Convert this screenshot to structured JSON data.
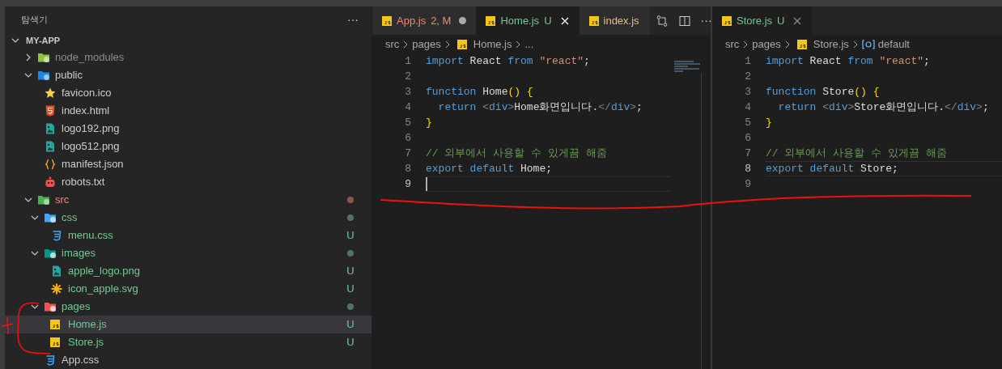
{
  "sidebar": {
    "title": "탐색기",
    "more": "···",
    "root": {
      "label": "MY-APP",
      "expanded": true
    },
    "tree": [
      {
        "label": "node_modules",
        "kind": "nodefolder",
        "color": "#8c8c8c",
        "expanded": false
      },
      {
        "label": "public",
        "kind": "publicfolder",
        "color": "#cccccc",
        "expanded": true,
        "children": [
          {
            "label": "favicon.ico",
            "kind": "star",
            "color": "#cccccc"
          },
          {
            "label": "index.html",
            "kind": "html",
            "color": "#cccccc"
          },
          {
            "label": "logo192.png",
            "kind": "image",
            "color": "#cccccc"
          },
          {
            "label": "logo512.png",
            "kind": "image",
            "color": "#cccccc"
          },
          {
            "label": "manifest.json",
            "kind": "json",
            "color": "#cccccc"
          },
          {
            "label": "robots.txt",
            "kind": "robot",
            "color": "#cccccc"
          }
        ]
      },
      {
        "label": "src",
        "kind": "srcfolder",
        "color": "#f48771",
        "expanded": true,
        "dot": true,
        "children": [
          {
            "label": "css",
            "kind": "cssfolder",
            "color": "#73c991",
            "expanded": true,
            "dot": true,
            "children": [
              {
                "label": "menu.css",
                "kind": "css",
                "color": "#73c991",
                "badge": "U"
              }
            ]
          },
          {
            "label": "images",
            "kind": "imagesfolder",
            "color": "#73c991",
            "expanded": true,
            "dot": true,
            "children": [
              {
                "label": "apple_logo.png",
                "kind": "image",
                "color": "#73c991",
                "badge": "U"
              },
              {
                "label": "icon_apple.svg",
                "kind": "svg",
                "color": "#73c991",
                "badge": "U"
              }
            ]
          },
          {
            "label": "pages",
            "kind": "pagesfolder",
            "color": "#73c991",
            "expanded": true,
            "dot": true,
            "children": [
              {
                "label": "Home.js",
                "kind": "js",
                "color": "#73c991",
                "badge": "U",
                "selected": true
              },
              {
                "label": "Store.js",
                "kind": "js",
                "color": "#73c991",
                "badge": "U",
                "selected": false
              }
            ]
          },
          {
            "label": "App.css",
            "kind": "css",
            "color": "#cccccc"
          }
        ]
      }
    ]
  },
  "editors": [
    {
      "tabs": [
        {
          "label": "App.js",
          "badge": "2, M",
          "color": "#f48771",
          "selected": false,
          "modified": true
        },
        {
          "label": "Home.js",
          "badge": "U",
          "color": "#73c991",
          "selected": true,
          "modified": false
        },
        {
          "label": "index.js",
          "color": "#e2c08d",
          "selected": false,
          "modified": false
        }
      ],
      "breadcrumb": [
        {
          "text": "src",
          "kind": "folder"
        },
        {
          "text": "pages",
          "kind": "folder"
        },
        {
          "text": "Home.js",
          "kind": "js"
        },
        {
          "text": "...",
          "kind": "folder"
        }
      ],
      "lines": [
        {
          "number": "1",
          "current": false,
          "tokens": [
            {
              "text": "import",
              "kind": "kw"
            },
            {
              "text": " React ",
              "kind": "var"
            },
            {
              "text": "from",
              "kind": "kw"
            },
            {
              "text": " \"react\"",
              "kind": "str"
            },
            {
              "text": ";",
              "kind": "plain"
            }
          ]
        },
        {
          "number": "2",
          "current": false
        },
        {
          "number": "3",
          "current": false,
          "tokens": [
            {
              "text": "function",
              "kind": "kw"
            },
            {
              "text": " Home",
              "kind": "fn"
            },
            {
              "text": "()",
              "kind": "br"
            },
            {
              "text": " {",
              "kind": "br"
            }
          ]
        },
        {
          "number": "4",
          "current": false,
          "tokens": [
            {
              "text": "  return",
              "kind": "kw"
            },
            {
              "text": " <",
              "kind": "tag"
            },
            {
              "text": "div",
              "kind": "kw"
            },
            {
              "text": ">",
              "kind": "tag"
            },
            {
              "text": "Home화면입니다.",
              "kind": "plain"
            },
            {
              "text": "</",
              "kind": "tag"
            },
            {
              "text": "div",
              "kind": "kw"
            },
            {
              "text": ">",
              "kind": "tag"
            },
            {
              "text": ";",
              "kind": "plain"
            }
          ]
        },
        {
          "number": "5",
          "current": false,
          "tokens": [
            {
              "text": "}",
              "kind": "br"
            }
          ]
        },
        {
          "number": "6",
          "current": false
        },
        {
          "number": "7",
          "current": false,
          "tokens": [
            {
              "text": "// 외부에서 사용할 수 있게끔 해줌",
              "kind": "cm"
            }
          ]
        },
        {
          "number": "8",
          "current": false,
          "tokens": [
            {
              "text": "export default",
              "kind": "kw"
            },
            {
              "text": " Home;",
              "kind": "plain"
            }
          ]
        },
        {
          "number": "9",
          "current": true,
          "cursor": true
        }
      ]
    },
    {
      "tabs": [
        {
          "label": "Store.js",
          "badge": "U",
          "color": "#73c991",
          "selected": true,
          "modified": false
        }
      ],
      "breadcrumb": [
        {
          "text": "src",
          "kind": "folder"
        },
        {
          "text": "pages",
          "kind": "folder"
        },
        {
          "text": "Store.js",
          "kind": "js"
        },
        {
          "text": "default",
          "kind": "symbol"
        }
      ],
      "lines": [
        {
          "number": "1",
          "current": false,
          "tokens": [
            {
              "text": "import",
              "kind": "kw"
            },
            {
              "text": " React ",
              "kind": "var"
            },
            {
              "text": "from",
              "kind": "kw"
            },
            {
              "text": " \"react\"",
              "kind": "str"
            },
            {
              "text": ";",
              "kind": "plain"
            }
          ]
        },
        {
          "number": "2",
          "current": false
        },
        {
          "number": "3",
          "current": false,
          "tokens": [
            {
              "text": "function",
              "kind": "kw"
            },
            {
              "text": " Store",
              "kind": "fn"
            },
            {
              "text": "()",
              "kind": "br"
            },
            {
              "text": " {",
              "kind": "br"
            }
          ]
        },
        {
          "number": "4",
          "current": false,
          "tokens": [
            {
              "text": "  return",
              "kind": "kw"
            },
            {
              "text": " <",
              "kind": "tag"
            },
            {
              "text": "div",
              "kind": "kw"
            },
            {
              "text": ">",
              "kind": "tag"
            },
            {
              "text": "Store화면입니다.",
              "kind": "plain"
            },
            {
              "text": "</",
              "kind": "tag"
            },
            {
              "text": "div",
              "kind": "kw"
            },
            {
              "text": ">",
              "kind": "tag"
            },
            {
              "text": ";",
              "kind": "plain"
            }
          ]
        },
        {
          "number": "5",
          "current": false,
          "tokens": [
            {
              "text": "}",
              "kind": "br"
            }
          ]
        },
        {
          "number": "6",
          "current": false
        },
        {
          "number": "7",
          "current": false,
          "tokens": [
            {
              "text": "// 외부에서 사용할 수 있게끔 해줌",
              "kind": "cm"
            }
          ]
        },
        {
          "number": "8",
          "current": true,
          "tokens": [
            {
              "text": "export default",
              "kind": "kw"
            },
            {
              "text": " Store;",
              "kind": "plain"
            }
          ]
        },
        {
          "number": "9",
          "current": false
        }
      ]
    }
  ]
}
